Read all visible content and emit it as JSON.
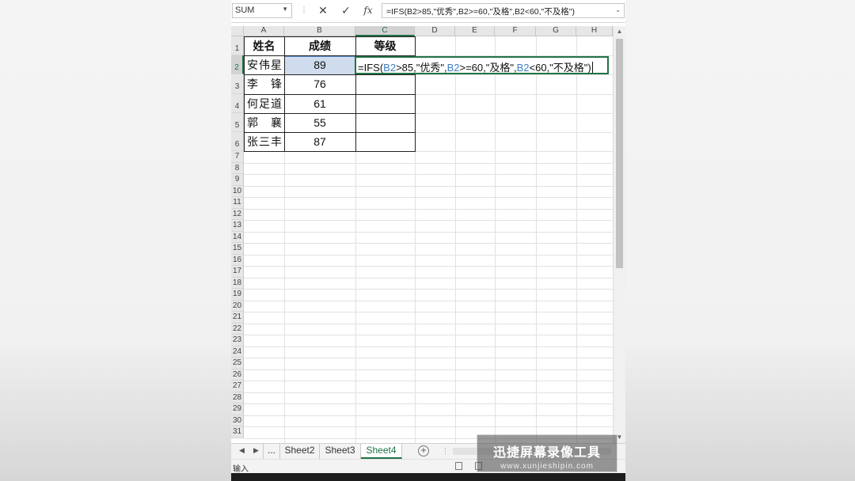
{
  "formula_bar": {
    "name_box": "SUM",
    "cancel_icon": "✕",
    "enter_icon": "✓",
    "fx_label": "fx",
    "formula": "=IFS(B2>85,\"优秀\",B2>=60,\"及格\",B2<60,\"不及格\")"
  },
  "columns": [
    "A",
    "B",
    "C",
    "D",
    "E",
    "F",
    "G",
    "H"
  ],
  "selected_column": "C",
  "selected_row": "2",
  "rows": [
    "1",
    "2",
    "3",
    "4",
    "5",
    "6",
    "7",
    "8",
    "9",
    "10",
    "11",
    "12",
    "13",
    "14",
    "15",
    "16",
    "17",
    "18",
    "19",
    "20",
    "21",
    "22",
    "23",
    "24",
    "25",
    "26",
    "27",
    "28",
    "29",
    "30",
    "31"
  ],
  "table": {
    "headers": [
      "姓名",
      "成绩",
      "等级"
    ],
    "records": [
      {
        "name": "安伟星",
        "score": "89"
      },
      {
        "name": "李　锋",
        "score": "76"
      },
      {
        "name": "何足道",
        "score": "61"
      },
      {
        "name": "郭　襄",
        "score": "55"
      },
      {
        "name": "张三丰",
        "score": "87"
      }
    ]
  },
  "cell_editor": {
    "p1": "=IFS(",
    "r1": "B2",
    "p2": ">85,\"优秀\",",
    "r2": "B2",
    "p3": ">=60,\"及格\",",
    "r3": "B2",
    "p4": "<60,\"不及格\")"
  },
  "sheet_tabs": {
    "overflow": "...",
    "tabs": [
      "Sheet2",
      "Sheet3",
      "Sheet4"
    ],
    "active": "Sheet4"
  },
  "status_bar": {
    "mode": "输入"
  },
  "watermark": {
    "title": "迅捷屏幕录像工具",
    "url": "www.xunjieshipin.com"
  },
  "colors": {
    "accent": "#217346",
    "ref": "#3d7ec6",
    "selection": "#cfdcee"
  }
}
